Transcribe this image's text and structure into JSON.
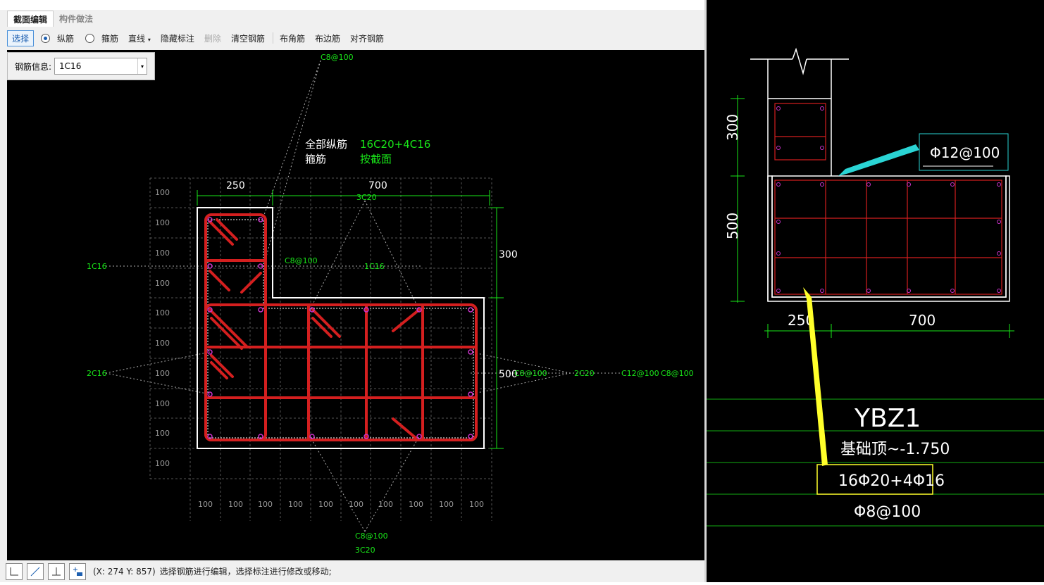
{
  "tabs": [
    {
      "label": "截面编辑",
      "active": true
    },
    {
      "label": "构件做法",
      "active": false
    }
  ],
  "toolbar": {
    "select_label": "选择",
    "longitudinal_label": "纵筋",
    "stirrup_label": "箍筋",
    "line_label": "直线",
    "hide_annot_label": "隐藏标注",
    "delete_label": "删除",
    "clear_label": "清空钢筋",
    "corner_label": "布角筋",
    "edge_label": "布边筋",
    "align_label": "对齐钢筋",
    "selected_mode": "纵筋"
  },
  "rebar_info": {
    "label": "钢筋信息:",
    "value": "1C16"
  },
  "canvas_labels": {
    "top_stirrup": "C8@100",
    "all_long_label": "全部纵筋",
    "all_long_value": "16C20+4C16",
    "stirrup_label": "箍筋",
    "stirrup_value": "按截面",
    "dim_250": "250",
    "dim_700": "700",
    "dim_300": "300",
    "dim_500": "500",
    "top_3c20": "3C20",
    "left_1c16": "1C16",
    "mid_c8": "C8@100",
    "mid_1c16": "1C16",
    "left_2c16": "2C16",
    "right_c8": "C8@100",
    "right_2c20": "2C20",
    "right_c12": "C12@100",
    "right_c8b": "C8@100",
    "bottom_c8": "C8@100",
    "bottom_3c20": "3C20",
    "grid_100": "100"
  },
  "status": {
    "coords": "(X: 274 Y: 857)",
    "message": "选择钢筋进行编辑，选择标注进行修改或移动;"
  },
  "drawing": {
    "dim_300": "300",
    "dim_500": "500",
    "dim_250": "250",
    "dim_700": "700",
    "callout": "Φ12@100",
    "name": "YBZ1",
    "elevation": "基础顶~-1.750",
    "long_bars": "16Φ20+4Φ16",
    "stirrups": "Φ8@100"
  },
  "colors": {
    "rebar": "#d41f1f",
    "green_text": "#19e619",
    "cyan_arrow": "#2ad4d4",
    "yellow_arrow": "#ffff2a"
  }
}
